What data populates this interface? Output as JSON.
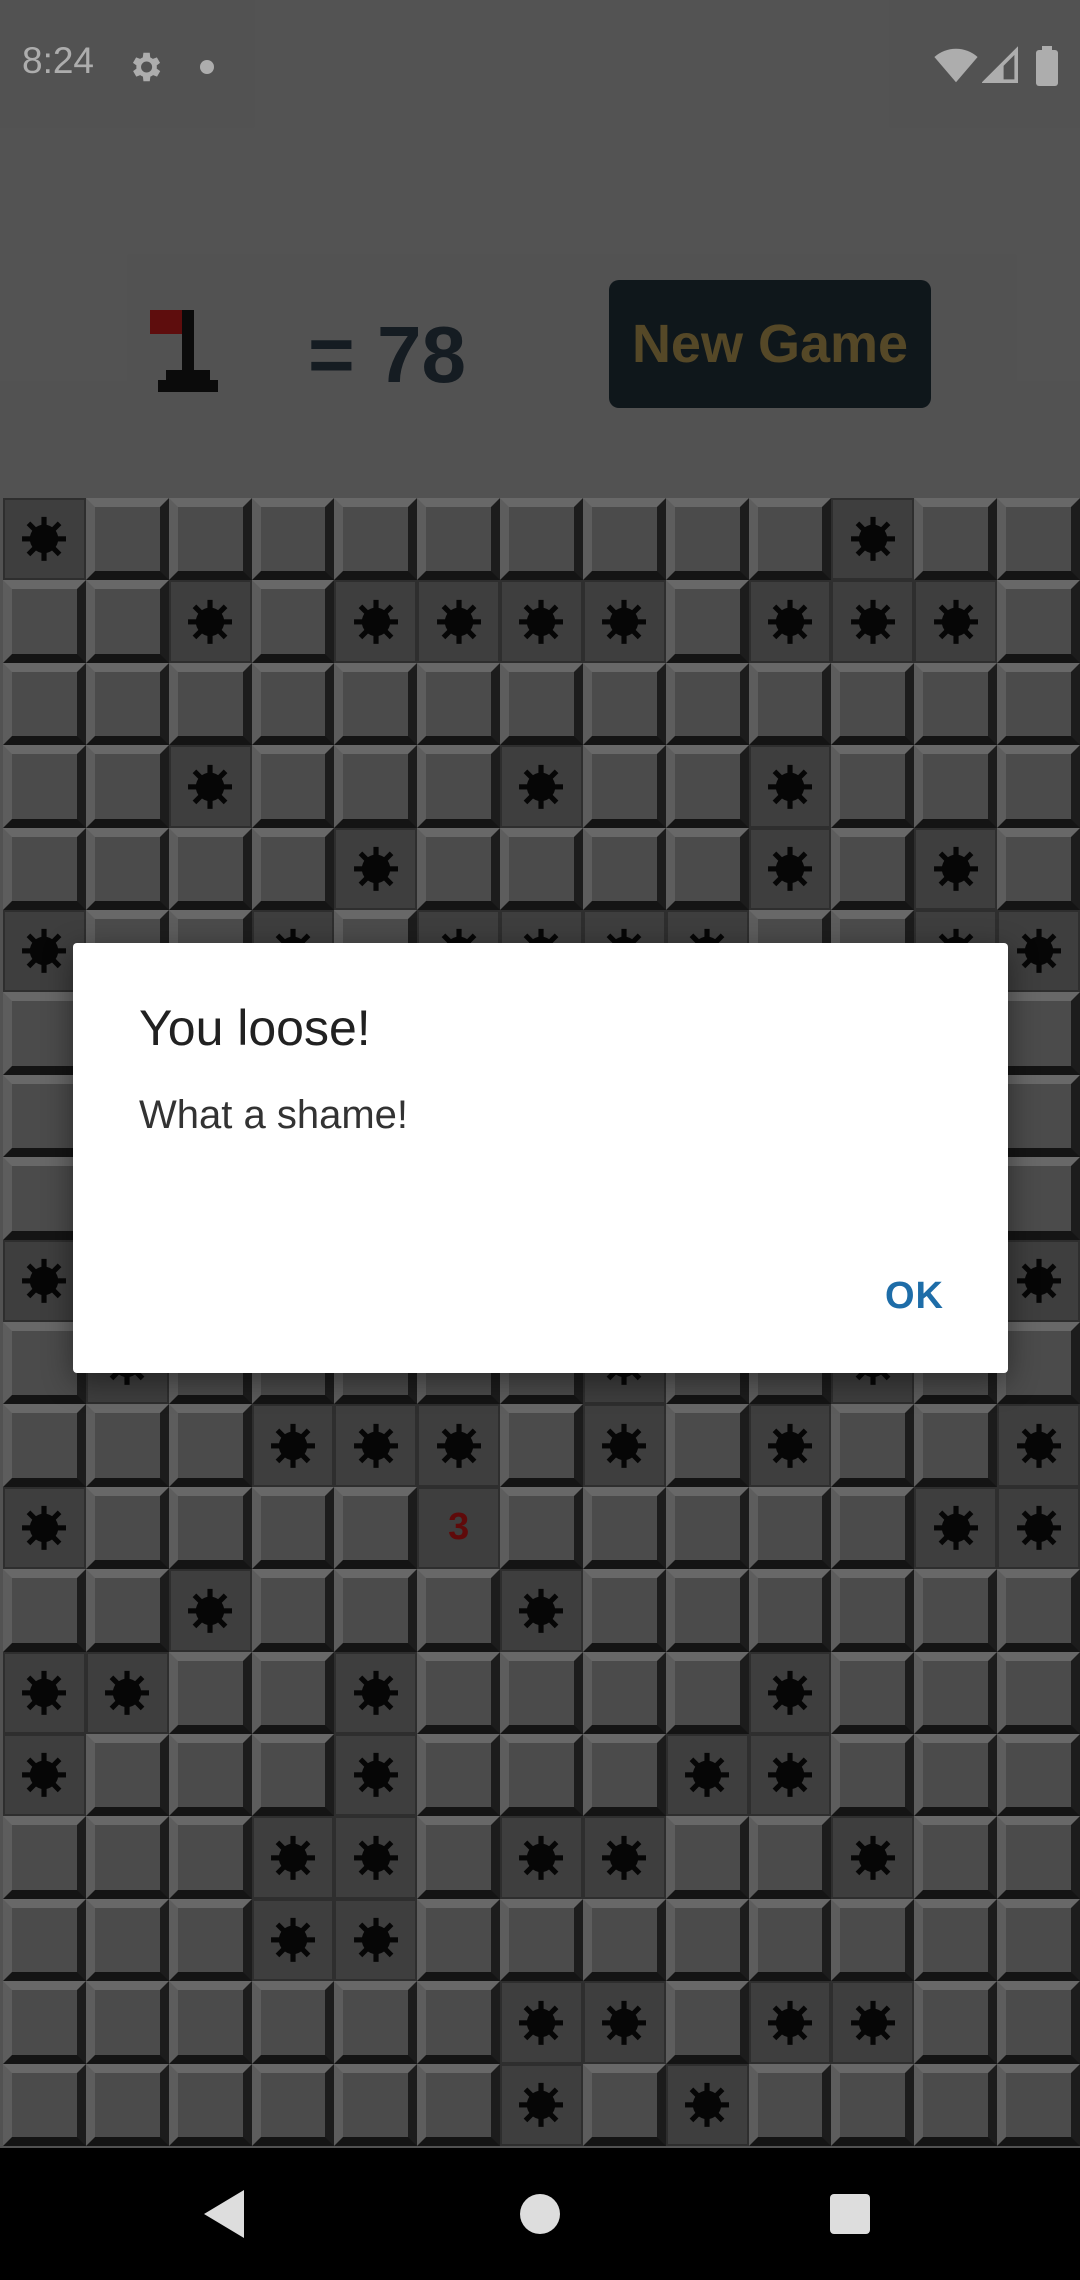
{
  "status_bar": {
    "time": "8:24",
    "icons": [
      "gear-icon",
      "notification-dot-icon",
      "wifi-icon",
      "cell-signal-icon",
      "battery-icon"
    ]
  },
  "header": {
    "flag_icon": "flag-icon",
    "mine_count": "= 78",
    "new_game_label": "New Game",
    "colors": {
      "counter": "#202a33",
      "button_bg": "#172229",
      "button_text": "#7e6a3a"
    }
  },
  "board": {
    "columns": 13,
    "rows": 20,
    "grid": [
      "MCCCCCCCCCMCC",
      "CCMCMMMMCMMMC",
      "CCCCCCCCCCCCC",
      "CCMCCCMCCMCCC",
      "CCCCMCCCCMCMC",
      "MCCMCMMMMCCMM",
      "CCCCCCCCCCCCC",
      "CCCCCCCCCCCCC",
      "CCCCCCCCCCCCC",
      "MCCCCCCCCCCCM",
      "CMCCCCCMCCMCC",
      "CCCMMMCMCMCCM",
      "MCCCC3CCCCCMM",
      "CCMCCCMCCCCCC",
      "MMCCMCCCCMCCC",
      "MCCCMCCCMMCCC",
      "CCCMMCMMCCMCC",
      "CCCMMCCCCCCCC",
      "CCCCCCMMCMMCC",
      "CCCCCCMCMCCCC"
    ],
    "legend": {
      "M": "mine",
      "C": "covered",
      "3": "number"
    },
    "colors": {
      "number": "#8c1010",
      "mine": "#0a0a0a"
    }
  },
  "dialog": {
    "title": "You loose!",
    "message": "What a shame!",
    "ok_label": "OK",
    "colors": {
      "ok": "#1e6da8"
    }
  },
  "nav_bar": {
    "icons": [
      "back-icon",
      "home-icon",
      "recents-icon"
    ]
  }
}
